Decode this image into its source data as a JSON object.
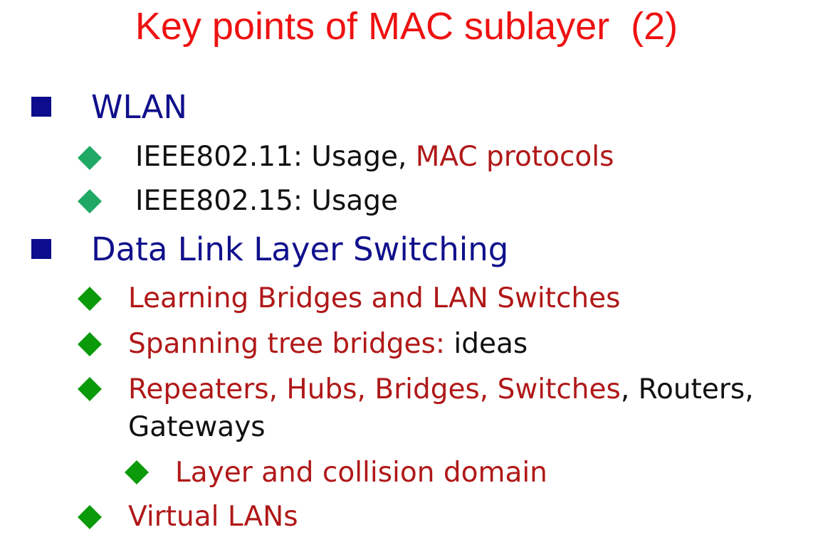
{
  "title": "Key points of MAC sublayer  (2)",
  "colors": {
    "title": "#ee1111",
    "level1_text": "#10108c",
    "level1_bullet": "#0c0c8c",
    "highlight_text": "#b01818",
    "plain_text": "#111111",
    "bullet_wlan_items": "#20a865",
    "bullet_switching_items": "#0a9a0a"
  },
  "sections": [
    {
      "heading": "WLAN",
      "items": [
        {
          "plain": "IEEE802.11: Usage, ",
          "highlight": "MAC protocols"
        },
        {
          "plain": "IEEE802.15: Usage"
        }
      ]
    },
    {
      "heading": "Data Link Layer Switching",
      "items": [
        {
          "highlight": "Learning Bridges and LAN Switches"
        },
        {
          "highlight": "Spanning tree bridges:",
          "plain": " ideas"
        },
        {
          "highlight": "Repeaters, Hubs, Bridges, Switches",
          "plain": ", Routers,",
          "continuation": "Gateways",
          "subitems": [
            {
              "highlight": "Layer and collision domain"
            }
          ]
        },
        {
          "highlight": "Virtual LANs"
        }
      ]
    }
  ]
}
